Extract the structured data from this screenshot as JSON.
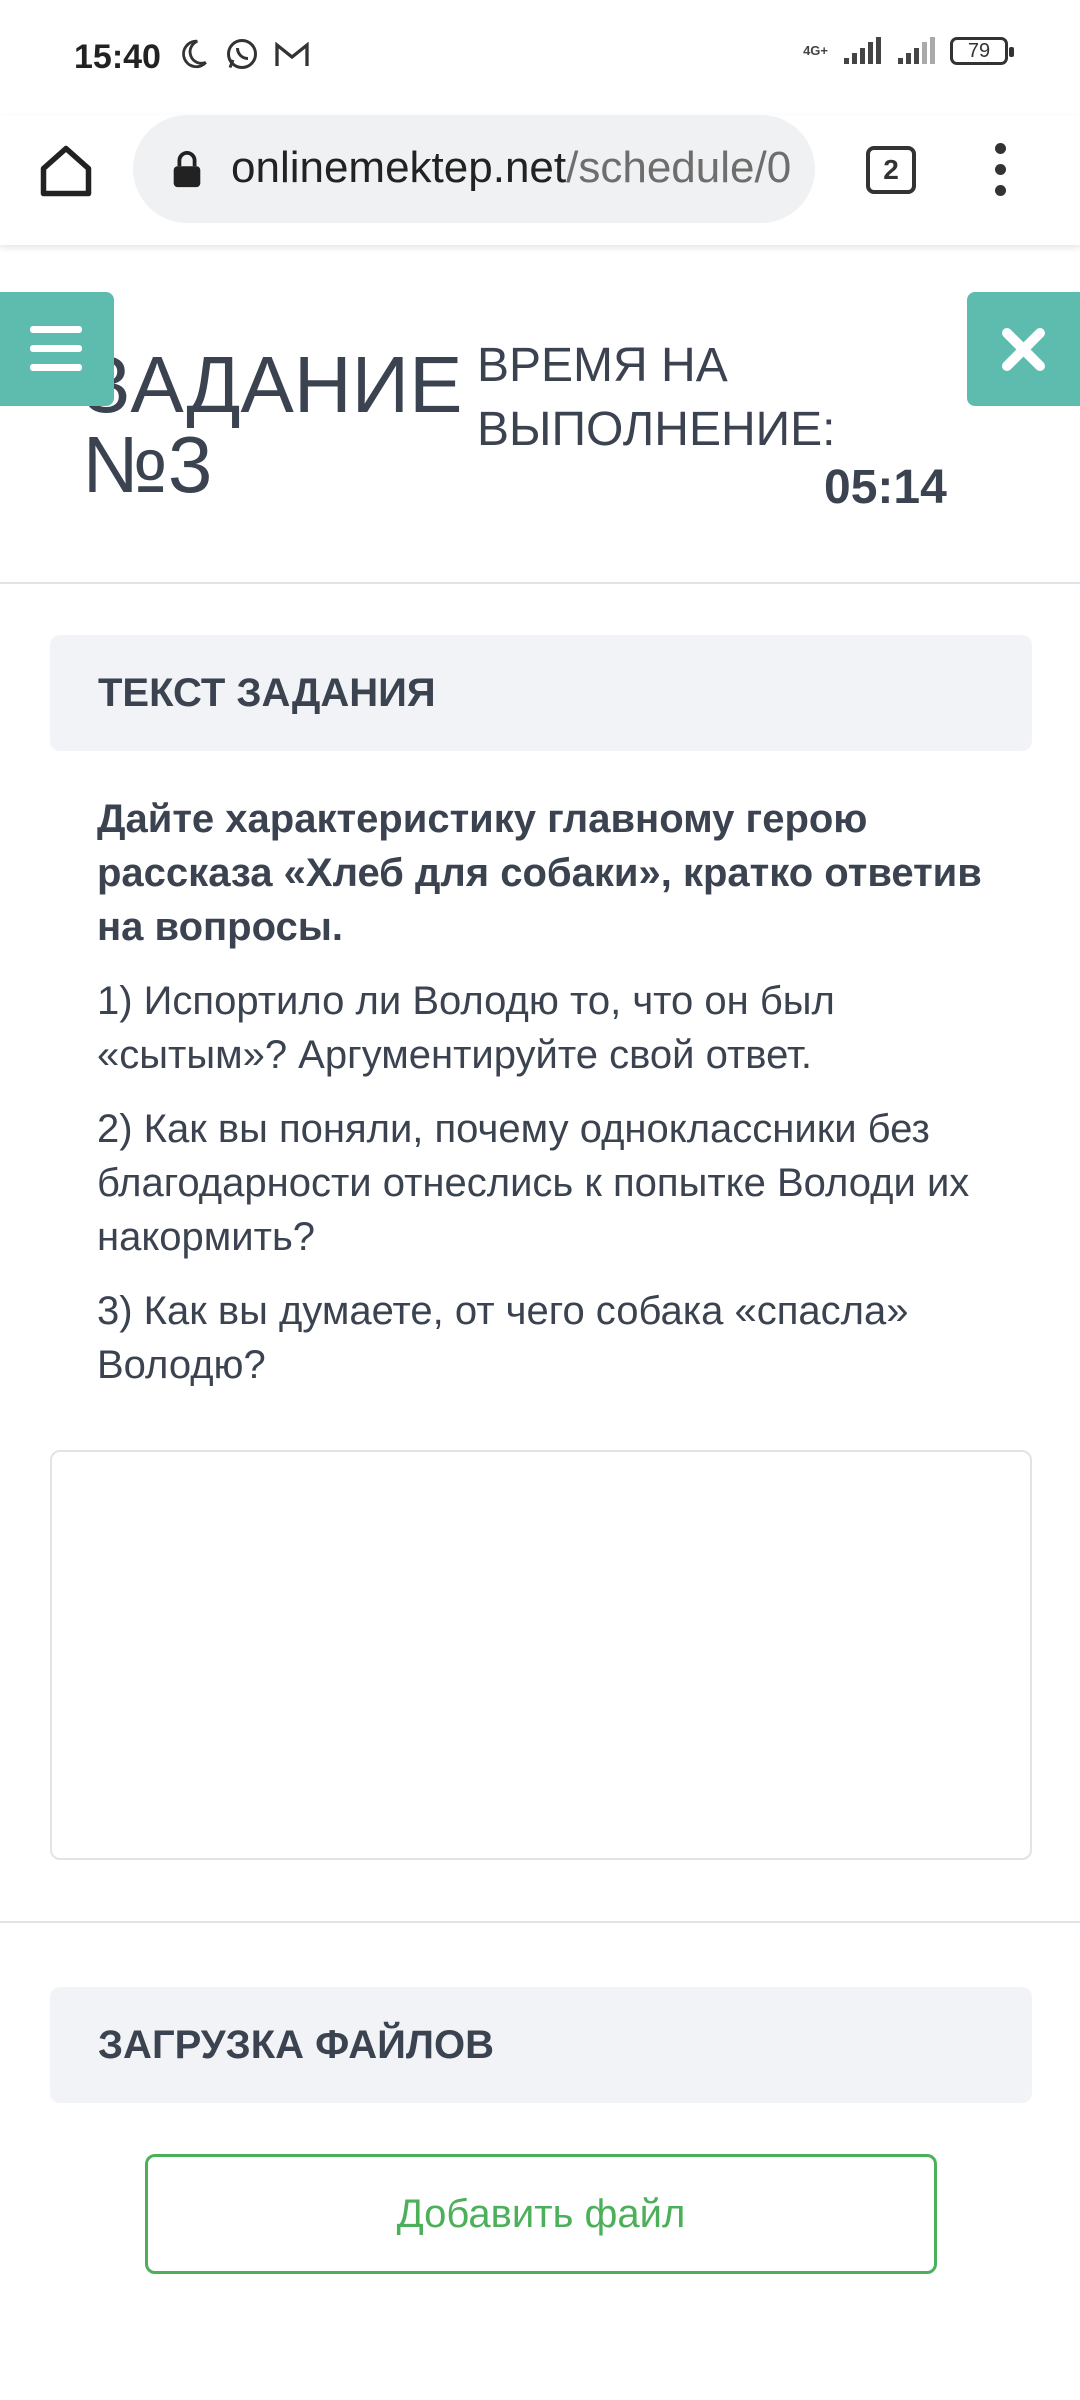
{
  "status_bar": {
    "time": "15:40",
    "network": "4G+",
    "battery": "79"
  },
  "browser": {
    "url_domain": "onlinemektep.net",
    "url_path": "/schedule/0",
    "tab_count": "2"
  },
  "header": {
    "task_title": "ЗАДАНИЕ №3",
    "timer_label": "ВРЕМЯ НА ВЫПОЛНЕНИЕ:",
    "timer_value": "05:14"
  },
  "task": {
    "section_title": "ТЕКСТ ЗАДАНИЯ",
    "intro": "Дайте характеристику главному герою рассказа «Хлеб для собаки», кратко ответив на вопросы.",
    "questions": [
      "1) Испортило ли Володю то, что он был «сытым»? Аргументируйте свой ответ.",
      "2) Как вы поняли, почему одноклассники без благодарности отнеслись к попытке Володи их накормить?",
      "3) Как вы думаете, от чего собака «спасла» Володю?"
    ],
    "answer_value": ""
  },
  "upload": {
    "section_title": "ЗАГРУЗКА ФАЙЛОВ",
    "add_file_label": "Добавить файл"
  },
  "colors": {
    "accent_teal": "#5dbcae",
    "green_button": "#4cb05a",
    "text": "#3b4350"
  },
  "icons": [
    "moon-icon",
    "whatsapp-icon",
    "gmail-icon",
    "signal-icon",
    "battery-icon",
    "home-icon",
    "lock-icon",
    "tabs-icon",
    "more-vert-icon",
    "hamburger-menu-icon",
    "close-icon"
  ]
}
